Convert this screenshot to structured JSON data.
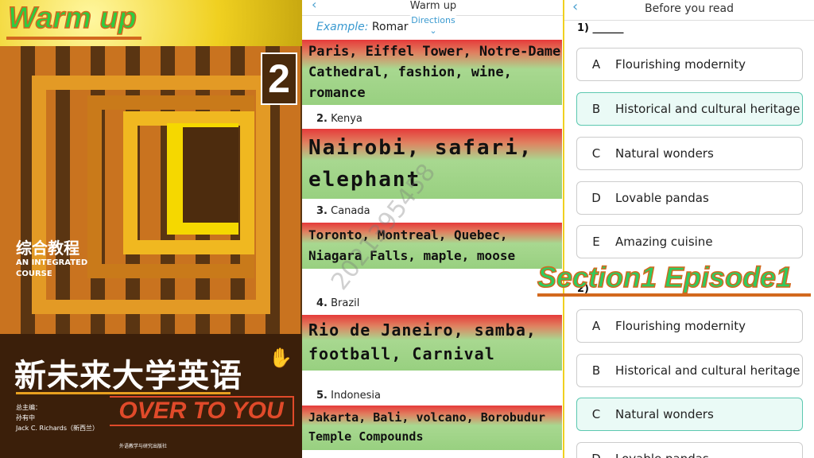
{
  "left": {
    "banner_title": "Warm up",
    "cover": {
      "volume": "2",
      "cn_subtitle": "综合教程",
      "en_subtitle": "AN INTEGRATED COURSE",
      "cn_title": "新未来大学英语",
      "en_title": "OVER TO YOU",
      "editors_label": "总主编：",
      "editor1": "孙有中",
      "editor2": "Jack C. Richards（新西兰）",
      "publisher": "外语教学与研究出版社"
    }
  },
  "middle": {
    "title": "Warm up",
    "example_label": "Example:",
    "example_text": "Romar",
    "directions": "Directions",
    "items": [
      {
        "label": "",
        "text": "Paris, Eiffel Tower, Notre-Dame Cathedral, fashion, wine, romance"
      },
      {
        "num": "2.",
        "country": "Kenya",
        "text": "Nairobi, safari, elephant"
      },
      {
        "num": "3.",
        "country": "Canada",
        "text": "Toronto, Montreal, Quebec, Niagara Falls, maple, moose"
      },
      {
        "num": "4.",
        "country": "Brazil",
        "text": "Rio de Janeiro, samba, football, Carnival"
      },
      {
        "num": "5.",
        "country": "Indonesia",
        "text": "Jakarta, Bali, volcano, Borobudur Temple Compounds"
      }
    ],
    "watermark": "2021395458"
  },
  "right": {
    "title": "Before you read",
    "q1": {
      "label": "1) ______",
      "options": [
        {
          "letter": "A",
          "text": "Flourishing modernity"
        },
        {
          "letter": "B",
          "text": "Historical and cultural heritage"
        },
        {
          "letter": "C",
          "text": "Natural wonders"
        },
        {
          "letter": "D",
          "text": "Lovable pandas"
        },
        {
          "letter": "E",
          "text": "Amazing cuisine"
        }
      ],
      "selected": "B"
    },
    "q2": {
      "label": "2)",
      "options": [
        {
          "letter": "A",
          "text": "Flourishing modernity"
        },
        {
          "letter": "B",
          "text": "Historical and cultural heritage"
        },
        {
          "letter": "C",
          "text": "Natural wonders"
        },
        {
          "letter": "D",
          "text": "Lovable pandas"
        }
      ],
      "selected": "C"
    }
  },
  "overlay": {
    "section": "Section1  Episode1"
  }
}
